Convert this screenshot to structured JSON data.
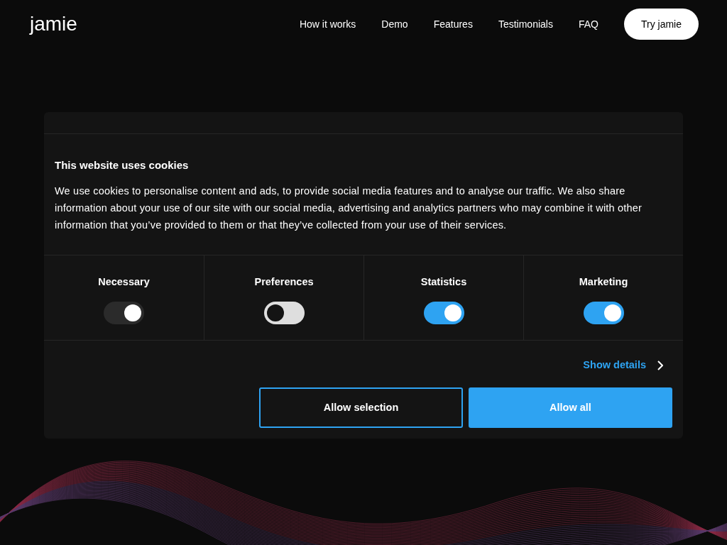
{
  "header": {
    "logo": "jamie",
    "nav": [
      "How it works",
      "Demo",
      "Features",
      "Testimonials",
      "FAQ"
    ],
    "cta": "Try jamie"
  },
  "cookie_dialog": {
    "title": "This website uses cookies",
    "body": "We use cookies to personalise content and ads, to provide social media features and to analyse our traffic. We also share information about your use of our site with our social media, advertising and analytics partners who may combine it with other information that you’ve provided to them or that they’ve collected from your use of their services.",
    "categories": [
      {
        "label": "Necessary",
        "checked": true,
        "disabled": true
      },
      {
        "label": "Preferences",
        "checked": false,
        "disabled": false
      },
      {
        "label": "Statistics",
        "checked": true,
        "disabled": false
      },
      {
        "label": "Marketing",
        "checked": true,
        "disabled": false
      }
    ],
    "show_details": "Show details",
    "buttons": [
      {
        "label": "Allow selection",
        "kind": "outline"
      },
      {
        "label": "Allow all",
        "kind": "filled"
      }
    ]
  }
}
